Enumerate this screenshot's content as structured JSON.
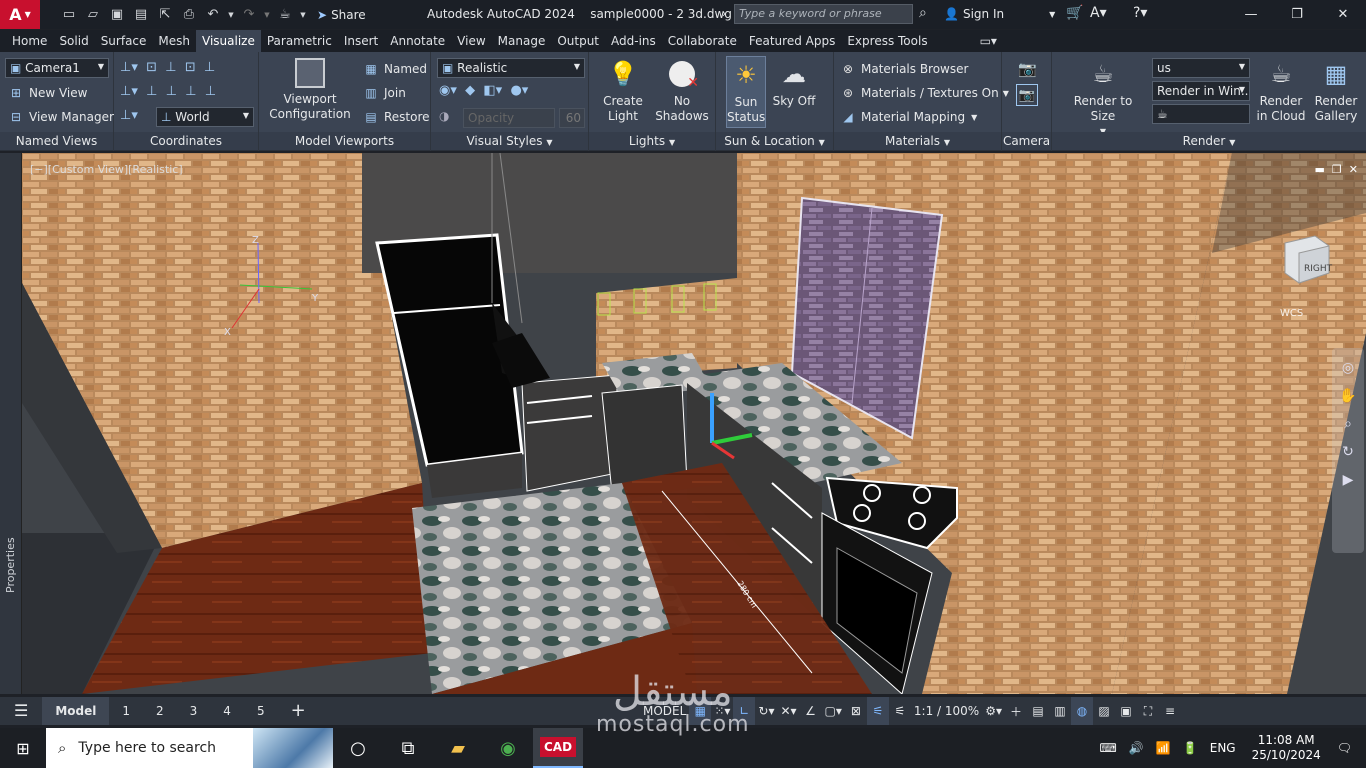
{
  "app": {
    "name": "Autodesk AutoCAD 2024",
    "file": "sample0000 - 2 3d.dwg",
    "logo_letter": "A",
    "share_label": "Share",
    "search_placeholder": "Type a keyword or phrase",
    "signin_label": "Sign In"
  },
  "ribbon_tabs": [
    "Home",
    "Solid",
    "Surface",
    "Mesh",
    "Visualize",
    "Parametric",
    "Insert",
    "Annotate",
    "View",
    "Manage",
    "Output",
    "Add-ins",
    "Collaborate",
    "Featured Apps",
    "Express Tools"
  ],
  "active_tab": "Visualize",
  "panels": {
    "named_views": {
      "title": "Named Views",
      "camera": "Camera1",
      "new_view": "New View",
      "view_manager": "View Manager"
    },
    "coordinates": {
      "title": "Coordinates",
      "ucs": "World"
    },
    "model_viewports": {
      "title": "Model Viewports",
      "config": "Viewport Configuration",
      "named": "Named",
      "join": "Join",
      "restore": "Restore"
    },
    "visual_styles": {
      "title": "Visual Styles",
      "style": "Realistic",
      "opacity_label": "Opacity",
      "opacity_value": "60"
    },
    "lights": {
      "title": "Lights",
      "create_light": "Create Light",
      "no_shadows": "No Shadows"
    },
    "sun_location": {
      "title": "Sun & Location",
      "sun_status": "Sun Status",
      "sky_off": "Sky Off"
    },
    "materials": {
      "title": "Materials",
      "browser": "Materials Browser",
      "textures": "Materials / Textures On",
      "mapping": "Material Mapping"
    },
    "camera": {
      "title": "Camera"
    },
    "render": {
      "title": "Render",
      "render_to_size": "Render to Size",
      "preset": "us",
      "render_in": "Render in Win...",
      "cloud": "Render in Cloud",
      "gallery": "Render Gallery"
    }
  },
  "viewport": {
    "label": "[−][Custom View][Realistic]",
    "viewcube_face": "RIGHT",
    "wcs": "WCS",
    "dimension_text": "280 cm",
    "axis_x": "X",
    "axis_y": "Y",
    "axis_z": "Z"
  },
  "left_palette": "Properties",
  "layout_tabs": [
    "Model",
    "1",
    "2",
    "3",
    "4",
    "5"
  ],
  "active_layout": "Model",
  "status": {
    "mode": "MODEL",
    "scale": "1:1 / 100%"
  },
  "taskbar": {
    "search_placeholder": "Type here to search",
    "lang": "ENG",
    "time": "11:08 AM",
    "date": "25/10/2024",
    "cad_label": "CAD"
  },
  "watermark": {
    "arabic": "مستقل",
    "latin": "mostaql.com"
  },
  "colors": {
    "accent": "#7fb8ff",
    "app_red": "#c8102e",
    "ribbon_bg": "#3b4453"
  }
}
